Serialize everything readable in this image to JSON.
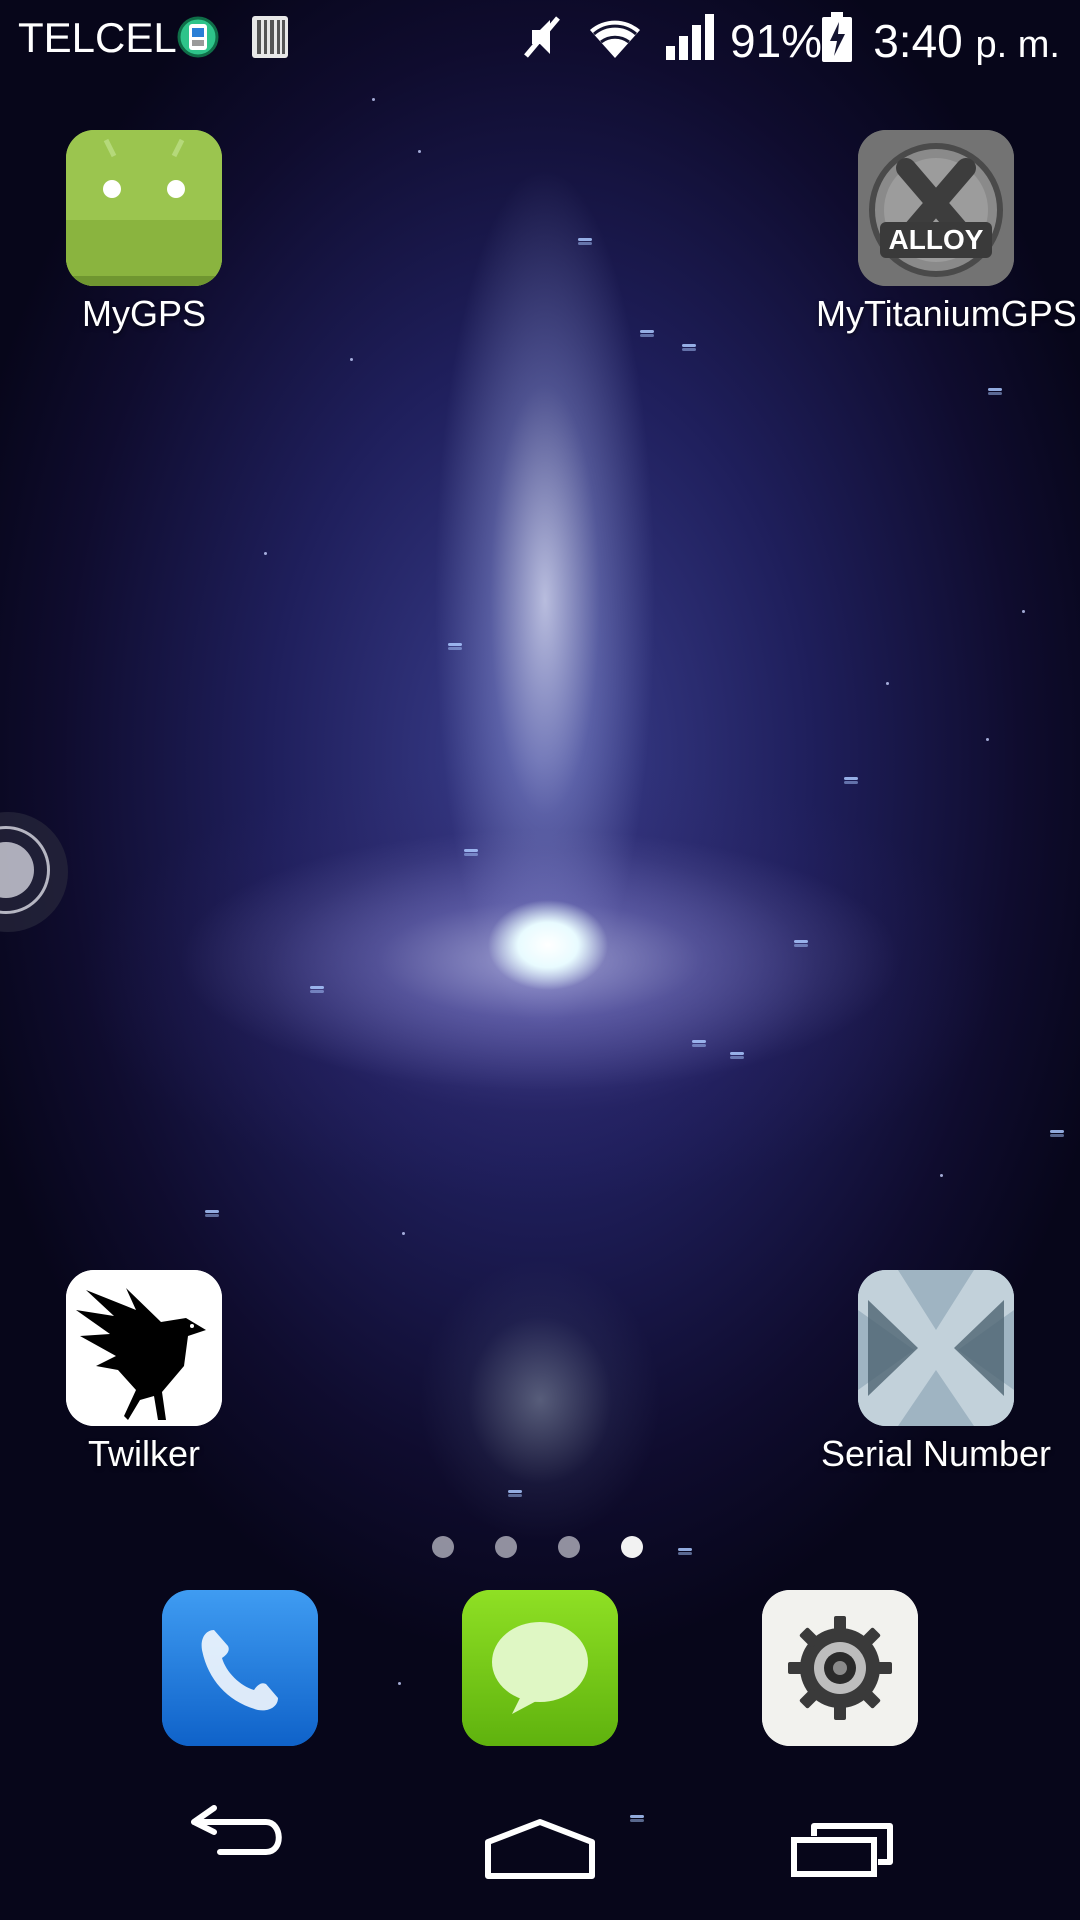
{
  "status_bar": {
    "carrier": "TELCEL",
    "battery_percent": "91%",
    "time": "3:40",
    "time_suffix": "p. m."
  },
  "home_apps": [
    {
      "label": "MyGPS",
      "icon": "android-robot-icon"
    },
    {
      "label": "MyTitaniumGPS",
      "icon": "alloy-logo-icon"
    },
    {
      "label": "Twilker",
      "icon": "crow-silhouette-icon"
    },
    {
      "label": "Serial Number",
      "icon": "xamarin-x-icon"
    }
  ],
  "page_indicator": {
    "pages": 4,
    "active_page": 4
  },
  "dock": [
    {
      "name": "Phone",
      "icon": "phone-handset-icon"
    },
    {
      "name": "Messaging",
      "icon": "speech-bubble-icon"
    },
    {
      "name": "Settings",
      "icon": "gear-icon"
    }
  ],
  "nav_bar": [
    "back-icon",
    "home-icon",
    "recent-apps-icon"
  ],
  "colors": {
    "wallpaper_core": "#3b3f8e",
    "wallpaper_edge": "#07061a",
    "android_green": "#97c24c",
    "phone_blue": "#1b7ce0",
    "messaging_green": "#7ed31a"
  }
}
